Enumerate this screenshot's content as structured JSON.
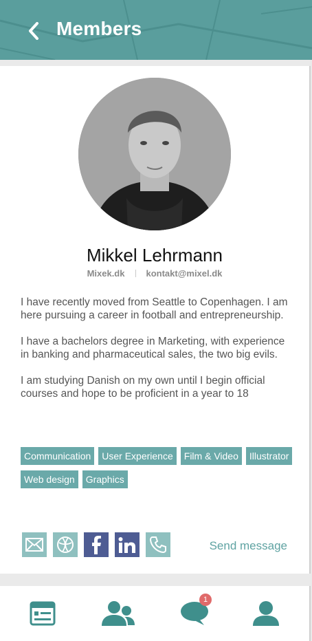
{
  "header": {
    "title": "Members",
    "back_icon": "chevron-left-icon",
    "background_color": "#5a9e9d"
  },
  "profile": {
    "name": "Mikkel Lehrmann",
    "website": "Mixek.dk",
    "email": "kontakt@mixel.dk",
    "bio": [
      "I have recently moved from Seattle to Copenhagen. I am here pursuing a career in football and entrepreneurship.",
      "I have a bachelors degree in Marketing, with experience in banking and pharmaceutical sales, the two big evils.",
      "I am studying Danish on my own until I begin official courses and hope to be proficient in a year to 18"
    ],
    "tags": [
      "Communication",
      "User Experience",
      "Film & Video",
      "Illustrator",
      "Web design",
      "Graphics"
    ]
  },
  "social": {
    "icons": [
      "mail-icon",
      "web-icon",
      "facebook-icon",
      "linkedin-icon",
      "phone-icon"
    ],
    "send_message": "Send message"
  },
  "tabbar": {
    "items": [
      "profile-card-icon",
      "members-icon",
      "messages-icon",
      "user-icon"
    ],
    "messages_badge": "1",
    "accent_color": "#3f8f8c"
  }
}
